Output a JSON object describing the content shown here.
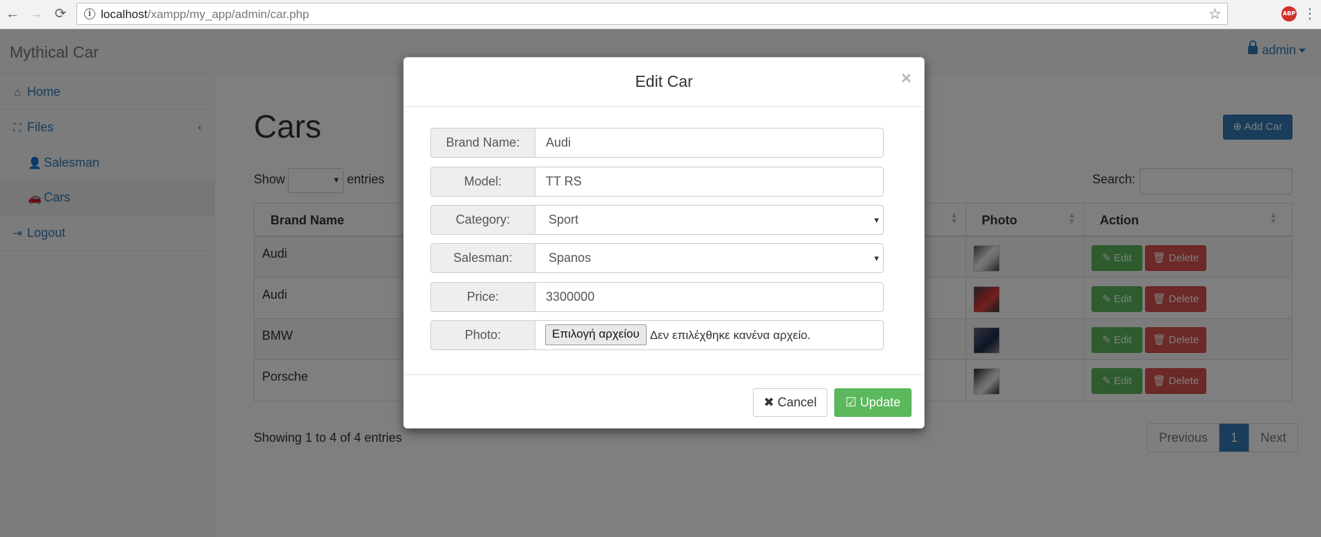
{
  "browser": {
    "url_host": "localhost",
    "url_path": "/xampp/my_app/admin/car.php",
    "extension_badge": "ABP"
  },
  "navbar": {
    "brand": "Mythical Car",
    "user": "admin"
  },
  "sidebar": {
    "items": [
      {
        "label": "Home",
        "icon": "home-icon"
      },
      {
        "label": "Files",
        "icon": "sitemap-icon"
      },
      {
        "label": "Salesman",
        "icon": "user-icon"
      },
      {
        "label": "Cars",
        "icon": "car-icon"
      },
      {
        "label": "Logout",
        "icon": "sign-out-icon"
      }
    ]
  },
  "main": {
    "title": "Cars",
    "add_button": "Add Car",
    "show_label": "Show",
    "entries_label": "entries",
    "search_label": "Search:",
    "columns": [
      "Brand Name",
      "Photo",
      "Action"
    ],
    "rows": [
      {
        "brand": "Audi"
      },
      {
        "brand": "Audi"
      },
      {
        "brand": "BMW"
      },
      {
        "brand": "Porsche"
      }
    ],
    "edit_label": "Edit",
    "delete_label": "Delete",
    "showing": "Showing 1 to 4 of 4 entries",
    "pagination": {
      "previous": "Previous",
      "current": "1",
      "next": "Next"
    }
  },
  "modal": {
    "title": "Edit Car",
    "close": "×",
    "fields": {
      "brand_label": "Brand Name:",
      "brand_value": "Audi",
      "model_label": "Model:",
      "model_value": "TT RS",
      "category_label": "Category:",
      "category_value": "Sport",
      "salesman_label": "Salesman:",
      "salesman_value": "Spanos",
      "price_label": "Price:",
      "price_value": "3300000",
      "photo_label": "Photo:",
      "file_button": "Επιλογή αρχείου",
      "file_status": "Δεν επιλέχθηκε κανένα αρχείο."
    },
    "cancel_label": "Cancel",
    "update_label": "Update"
  },
  "colors": {
    "primary": "#337ab7",
    "success": "#5cb85c",
    "danger": "#d9534f"
  }
}
